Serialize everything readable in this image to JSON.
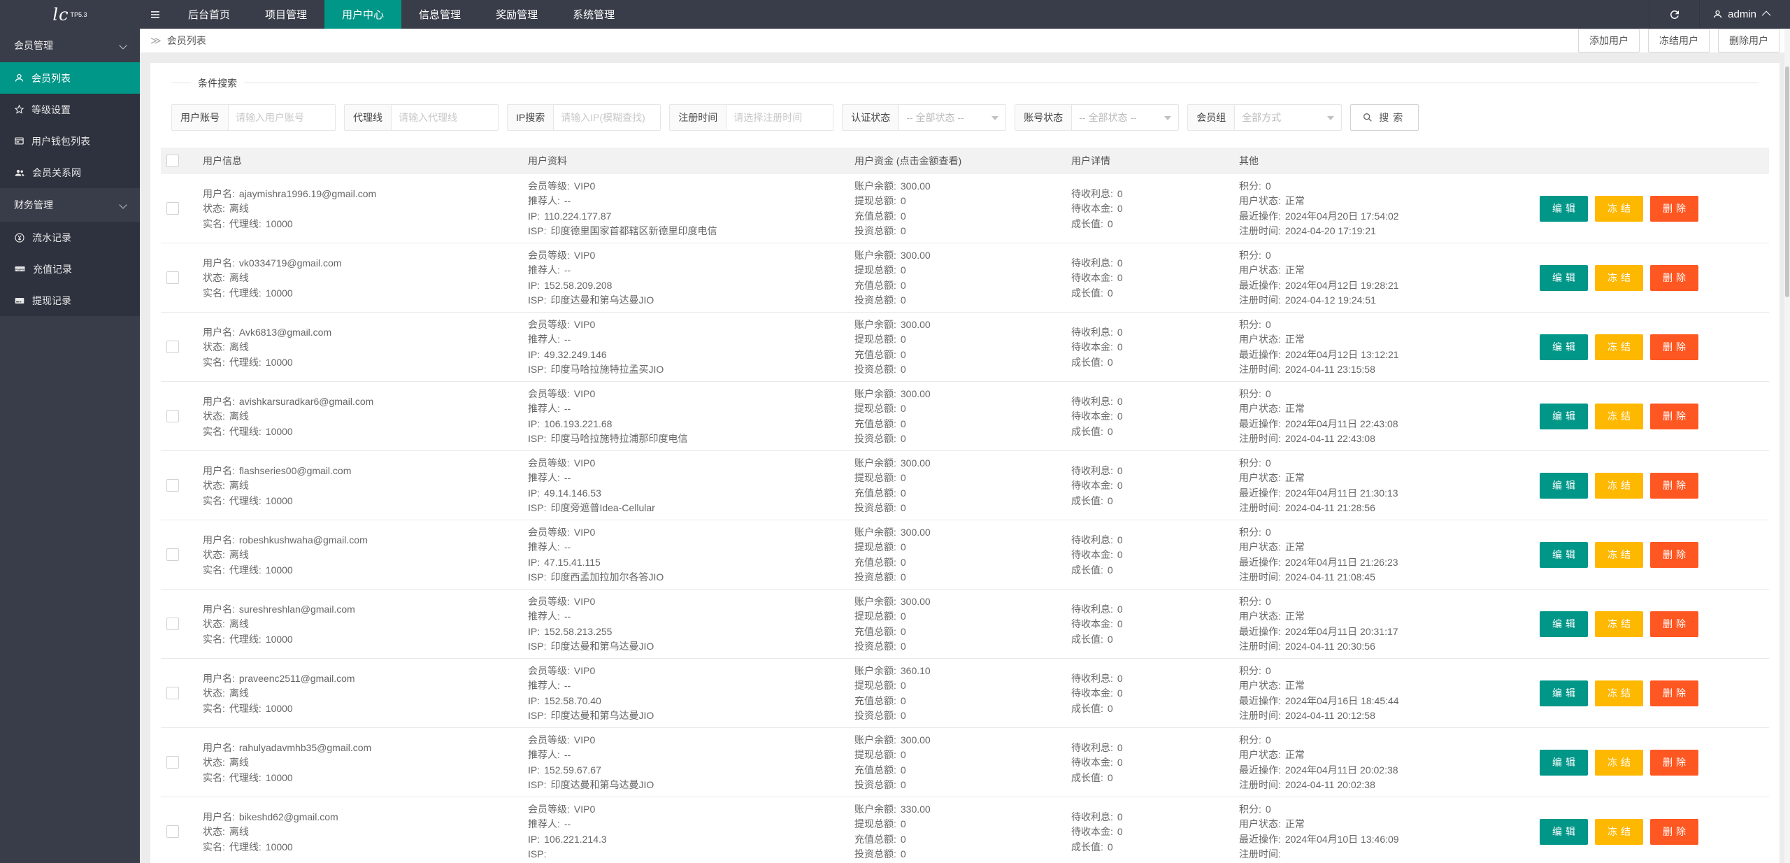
{
  "navbar": {
    "logo": "lc",
    "logo_badge": "TP5.3",
    "items": [
      {
        "label": "后台首页",
        "active": false
      },
      {
        "label": "项目管理",
        "active": false
      },
      {
        "label": "用户中心",
        "active": true
      },
      {
        "label": "信息管理",
        "active": false
      },
      {
        "label": "奖励管理",
        "active": false
      },
      {
        "label": "系统管理",
        "active": false
      }
    ],
    "user": {
      "name": "admin"
    }
  },
  "sidebar": {
    "sections": [
      {
        "title": "会员管理",
        "items": [
          {
            "label": "会员列表",
            "icon": "user-icon",
            "active": true
          },
          {
            "label": "等级设置",
            "icon": "star-icon",
            "active": false
          },
          {
            "label": "用户钱包列表",
            "icon": "wallet-icon",
            "active": false
          },
          {
            "label": "会员关系网",
            "icon": "users-icon",
            "active": false
          }
        ]
      },
      {
        "title": "财务管理",
        "items": [
          {
            "label": "流水记录",
            "icon": "yen-circle-icon",
            "active": false
          },
          {
            "label": "充值记录",
            "icon": "paypal-icon",
            "active": false
          },
          {
            "label": "提现记录",
            "icon": "credit-card-icon",
            "active": false
          }
        ]
      }
    ]
  },
  "breadcrumb": {
    "icon": "≫",
    "label": "会员列表"
  },
  "toolbar": {
    "add": "添加用户",
    "freeze": "冻结用户",
    "delete": "删除用户"
  },
  "search": {
    "legend": "条件搜索",
    "account": {
      "label": "用户账号",
      "placeholder": "请输入用户账号"
    },
    "agent": {
      "label": "代理线",
      "placeholder": "请输入代理线"
    },
    "ip": {
      "label": "IP搜索",
      "placeholder": "请输入IP(模糊查找)"
    },
    "regtime": {
      "label": "注册时间",
      "placeholder": "请选择注册时间"
    },
    "auth_status": {
      "label": "认证状态",
      "value": "-- 全部状态 --"
    },
    "account_status": {
      "label": "账号状态",
      "value": "-- 全部状态 --"
    },
    "member_group": {
      "label": "会员组",
      "value": "全部方式"
    },
    "button": "搜索"
  },
  "table": {
    "headers": [
      "用户信息",
      "用户资料",
      "用户资金 (点击金额查看)",
      "用户详情",
      "其他"
    ],
    "labels": {
      "username": "用户名:",
      "status": "状态:",
      "realname": "实名:",
      "agent_line": "代理线:",
      "level": "会员等级:",
      "referrer": "推荐人:",
      "ip": "IP:",
      "isp": "ISP:",
      "balance": "账户余额:",
      "withdraw": "提现总额:",
      "recharge": "充值总额:",
      "invest": "投资总额:",
      "interest": "待收利息:",
      "principal": "待收本金:",
      "growth": "成长值:",
      "points": "积分:",
      "user_status": "用户状态:",
      "last_op": "最近操作:",
      "reg_time": "注册时间:"
    },
    "actions": {
      "edit": "编辑",
      "freeze": "冻结",
      "delete": "删除"
    },
    "rows": [
      {
        "username": "ajaymishra1996.19@gmail.com",
        "status": "离线",
        "agent_line": "10000",
        "level": "VIP0",
        "referrer": "--",
        "ip": "110.224.177.87",
        "isp": "印度德里国家首都辖区新德里印度电信",
        "balance": "300.00",
        "withdraw": "0",
        "recharge": "0",
        "invest": "0",
        "interest": "0",
        "principal": "0",
        "growth": "0",
        "points": "0",
        "user_status": "正常",
        "last_op": "2024年04月20日 17:54:02",
        "reg_time": "2024-04-20 17:19:21"
      },
      {
        "username": "vk0334719@gmail.com",
        "status": "离线",
        "agent_line": "10000",
        "level": "VIP0",
        "referrer": "--",
        "ip": "152.58.209.208",
        "isp": "印度达曼和第乌达曼JIO",
        "balance": "300.00",
        "withdraw": "0",
        "recharge": "0",
        "invest": "0",
        "interest": "0",
        "principal": "0",
        "growth": "0",
        "points": "0",
        "user_status": "正常",
        "last_op": "2024年04月12日 19:28:21",
        "reg_time": "2024-04-12 19:24:51"
      },
      {
        "username": "Avk6813@gmail.com",
        "status": "离线",
        "agent_line": "10000",
        "level": "VIP0",
        "referrer": "--",
        "ip": "49.32.249.146",
        "isp": "印度马哈拉施特拉孟买JIO",
        "balance": "300.00",
        "withdraw": "0",
        "recharge": "0",
        "invest": "0",
        "interest": "0",
        "principal": "0",
        "growth": "0",
        "points": "0",
        "user_status": "正常",
        "last_op": "2024年04月12日 13:12:21",
        "reg_time": "2024-04-11 23:15:58"
      },
      {
        "username": "avishkarsuradkar6@gmail.com",
        "status": "离线",
        "agent_line": "10000",
        "level": "VIP0",
        "referrer": "--",
        "ip": "106.193.221.68",
        "isp": "印度马哈拉施特拉浦那印度电信",
        "balance": "300.00",
        "withdraw": "0",
        "recharge": "0",
        "invest": "0",
        "interest": "0",
        "principal": "0",
        "growth": "0",
        "points": "0",
        "user_status": "正常",
        "last_op": "2024年04月11日 22:43:08",
        "reg_time": "2024-04-11 22:43:08"
      },
      {
        "username": "flashseries00@gmail.com",
        "status": "离线",
        "agent_line": "10000",
        "level": "VIP0",
        "referrer": "--",
        "ip": "49.14.146.53",
        "isp": "印度旁遮普Idea-Cellular",
        "balance": "300.00",
        "withdraw": "0",
        "recharge": "0",
        "invest": "0",
        "interest": "0",
        "principal": "0",
        "growth": "0",
        "points": "0",
        "user_status": "正常",
        "last_op": "2024年04月11日 21:30:13",
        "reg_time": "2024-04-11 21:28:56"
      },
      {
        "username": "robeshkushwaha@gmail.com",
        "status": "离线",
        "agent_line": "10000",
        "level": "VIP0",
        "referrer": "--",
        "ip": "47.15.41.115",
        "isp": "印度西孟加拉加尔各答JIO",
        "balance": "300.00",
        "withdraw": "0",
        "recharge": "0",
        "invest": "0",
        "interest": "0",
        "principal": "0",
        "growth": "0",
        "points": "0",
        "user_status": "正常",
        "last_op": "2024年04月11日 21:26:23",
        "reg_time": "2024-04-11 21:08:45"
      },
      {
        "username": "sureshreshlan@gmail.com",
        "status": "离线",
        "agent_line": "10000",
        "level": "VIP0",
        "referrer": "--",
        "ip": "152.58.213.255",
        "isp": "印度达曼和第乌达曼JIO",
        "balance": "300.00",
        "withdraw": "0",
        "recharge": "0",
        "invest": "0",
        "interest": "0",
        "principal": "0",
        "growth": "0",
        "points": "0",
        "user_status": "正常",
        "last_op": "2024年04月11日 20:31:17",
        "reg_time": "2024-04-11 20:30:56"
      },
      {
        "username": "praveenc2511@gmail.com",
        "status": "离线",
        "agent_line": "10000",
        "level": "VIP0",
        "referrer": "--",
        "ip": "152.58.70.40",
        "isp": "印度达曼和第乌达曼JIO",
        "balance": "360.10",
        "withdraw": "0",
        "recharge": "0",
        "invest": "0",
        "interest": "0",
        "principal": "0",
        "growth": "0",
        "points": "0",
        "user_status": "正常",
        "last_op": "2024年04月16日 18:45:44",
        "reg_time": "2024-04-11 20:12:58"
      },
      {
        "username": "rahulyadavmhb35@gmail.com",
        "status": "离线",
        "agent_line": "10000",
        "level": "VIP0",
        "referrer": "--",
        "ip": "152.59.67.67",
        "isp": "印度达曼和第乌达曼JIO",
        "balance": "300.00",
        "withdraw": "0",
        "recharge": "0",
        "invest": "0",
        "interest": "0",
        "principal": "0",
        "growth": "0",
        "points": "0",
        "user_status": "正常",
        "last_op": "2024年04月11日 20:02:38",
        "reg_time": "2024-04-11 20:02:38"
      },
      {
        "username": "bikeshd62@gmail.com",
        "status": "离线",
        "agent_line": "10000",
        "level": "VIP0",
        "referrer": "--",
        "ip": "106.221.214.3",
        "isp": "",
        "balance": "330.00",
        "withdraw": "0",
        "recharge": "0",
        "invest": "0",
        "interest": "0",
        "principal": "0",
        "growth": "0",
        "points": "0",
        "user_status": "正常",
        "last_op": "2024年04月10日 13:46:09",
        "reg_time": ""
      }
    ]
  },
  "colors": {
    "accent_teal": "#009688",
    "navbar_bg": "#393D49",
    "link_blue": "#1E9FFF",
    "balance_red": "#FF0000",
    "money_green": "#009900",
    "money_orange": "#FFB800",
    "money_blue": "#1E9FFF",
    "status_green": "#009900",
    "btn_edit": "#009688",
    "btn_freeze": "#FFB800",
    "btn_delete": "#FF5722"
  }
}
